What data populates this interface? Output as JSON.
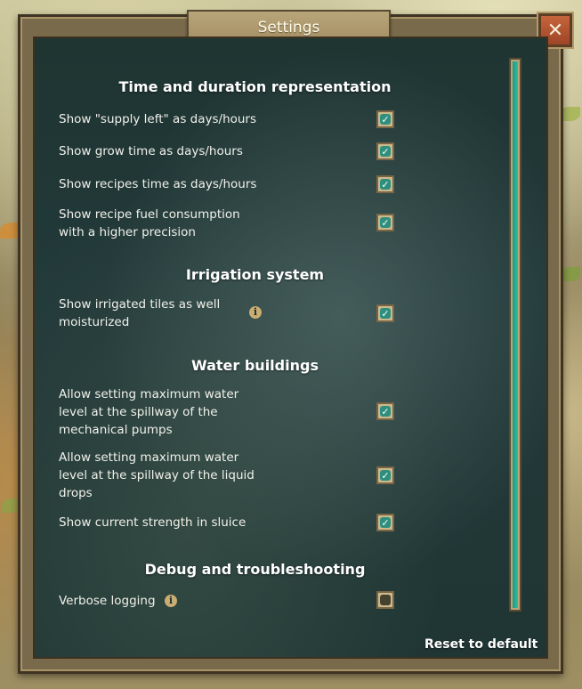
{
  "dialog": {
    "title": "Settings",
    "close_icon": "close-x-icon",
    "reset_label": "Reset to default"
  },
  "sections": [
    {
      "title": "Time and duration representation",
      "options": [
        {
          "label": "Show \"supply left\" as days/hours",
          "checked": true,
          "info": false
        },
        {
          "label": "Show grow time as days/hours",
          "checked": true,
          "info": false
        },
        {
          "label": "Show recipes time as days/hours",
          "checked": true,
          "info": false
        },
        {
          "label": "Show recipe fuel consumption with a higher precision",
          "checked": true,
          "info": false
        }
      ]
    },
    {
      "title": "Irrigation system",
      "options": [
        {
          "label": "Show irrigated tiles as well moisturized",
          "checked": true,
          "info": true
        }
      ]
    },
    {
      "title": "Water buildings",
      "options": [
        {
          "label": "Allow setting maximum water level at the spillway of the mechanical pumps",
          "checked": true,
          "info": false
        },
        {
          "label": "Allow setting maximum water level at the spillway of the liquid drops",
          "checked": true,
          "info": false
        },
        {
          "label": "Show current strength in sluice",
          "checked": true,
          "info": false
        }
      ]
    },
    {
      "title": "Debug and troubleshooting",
      "options": [
        {
          "label": "Verbose logging",
          "checked": false,
          "info": true
        }
      ]
    }
  ],
  "icons": {
    "info": "info-icon",
    "check": "checkmark-icon"
  },
  "colors": {
    "panel": "#22393a",
    "frame": "#7a6a4c",
    "checkbox_on": "#2f8f7f",
    "scroll_thumb": "#2fbd9e",
    "close_button": "#b0532f"
  }
}
